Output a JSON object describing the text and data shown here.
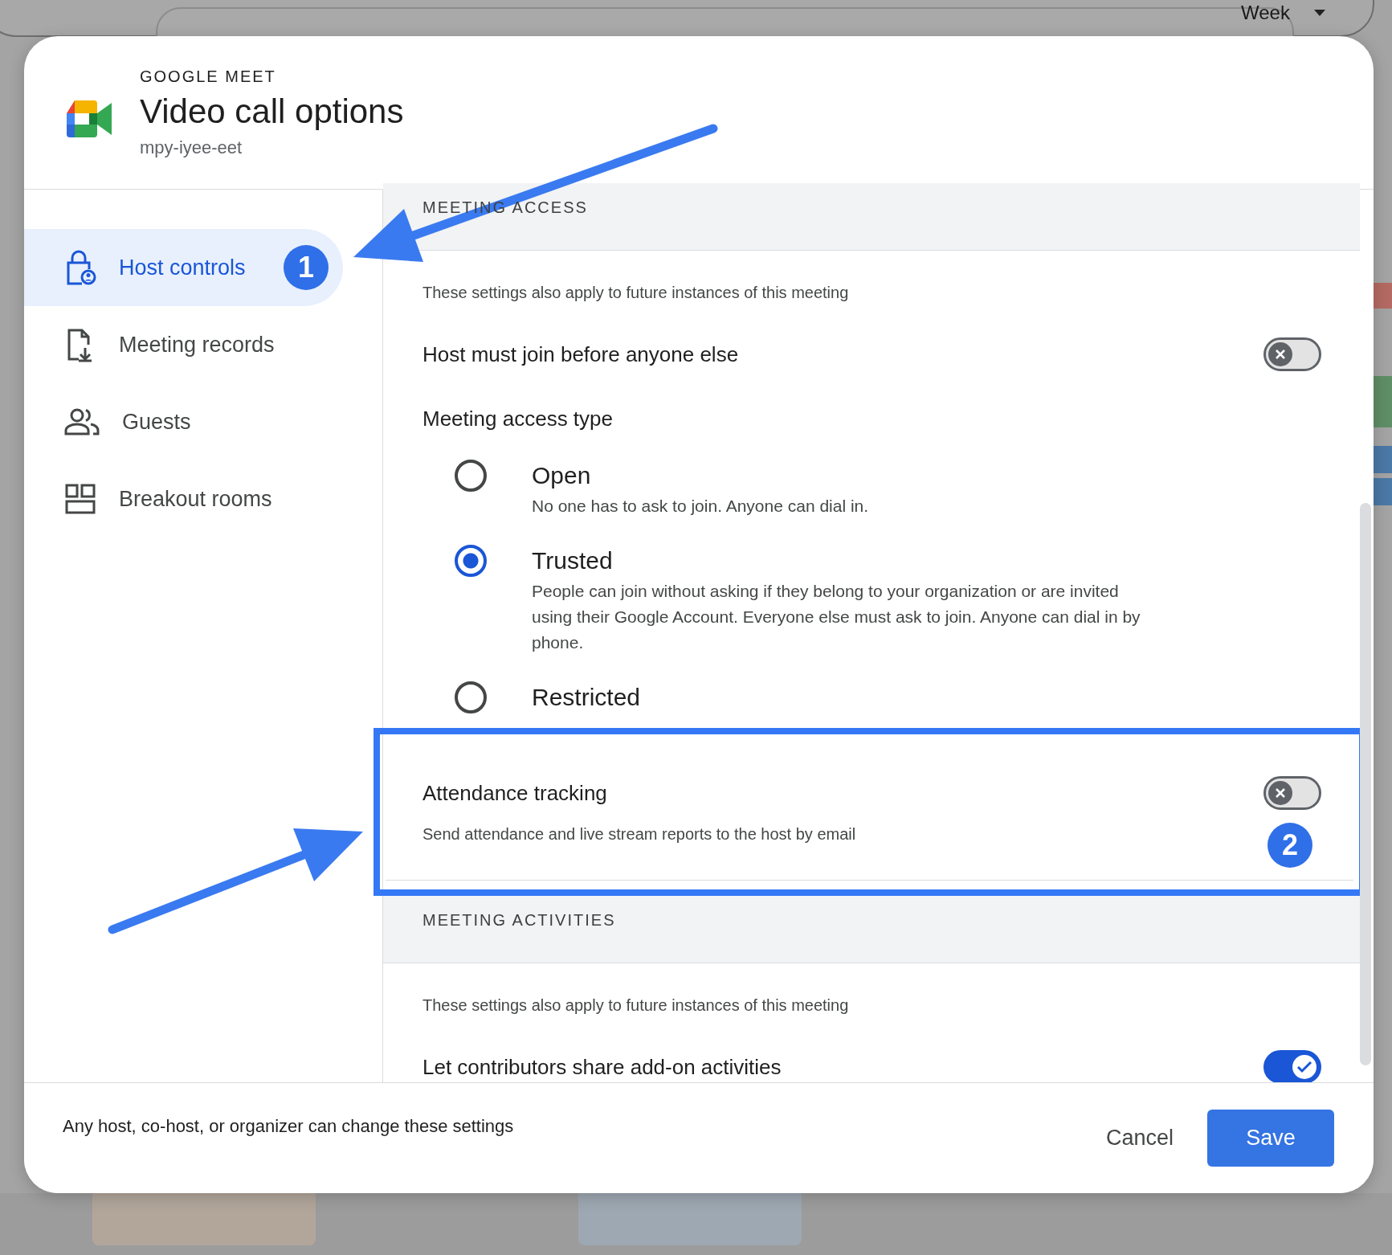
{
  "background": {
    "view": "Week"
  },
  "dialog": {
    "overline": "GOOGLE MEET",
    "title": "Video call options",
    "meeting_code": "mpy-iyee-eet"
  },
  "sidebar": {
    "items": [
      {
        "label": "Host controls",
        "selected": true,
        "badge": "1"
      },
      {
        "label": "Meeting records",
        "selected": false
      },
      {
        "label": "Guests",
        "selected": false
      },
      {
        "label": "Breakout rooms",
        "selected": false
      }
    ]
  },
  "sections": [
    {
      "heading": "MEETING ACCESS",
      "note": "These settings also apply to future instances of this meeting",
      "rows": [
        {
          "kind": "toggle",
          "label": "Host must join before anyone else",
          "on": false
        },
        {
          "kind": "radio-group",
          "label": "Meeting access type",
          "options": [
            {
              "label": "Open",
              "description": "No one has to ask to join. Anyone can dial in.",
              "selected": false
            },
            {
              "label": "Trusted",
              "description": "People can join without asking if they belong to your organization or are invited using their Google Account. Everyone else must ask to join. Anyone can dial in by phone.",
              "selected": true
            },
            {
              "label": "Restricted",
              "selected": false
            }
          ]
        },
        {
          "kind": "toggle",
          "label": "Attendance tracking",
          "description": "Send attendance and live stream reports to the host by email",
          "on": false,
          "highlighted": true,
          "badge": "2"
        }
      ]
    },
    {
      "heading": "MEETING ACTIVITIES",
      "note": "These settings also apply to future instances of this meeting",
      "rows": [
        {
          "kind": "toggle",
          "label": "Let contributors share add-on activities",
          "on": true
        }
      ]
    }
  ],
  "footer": {
    "note": "Any host, co-host, or organizer can change these settings",
    "buttons": [
      "Cancel",
      "Save"
    ]
  }
}
